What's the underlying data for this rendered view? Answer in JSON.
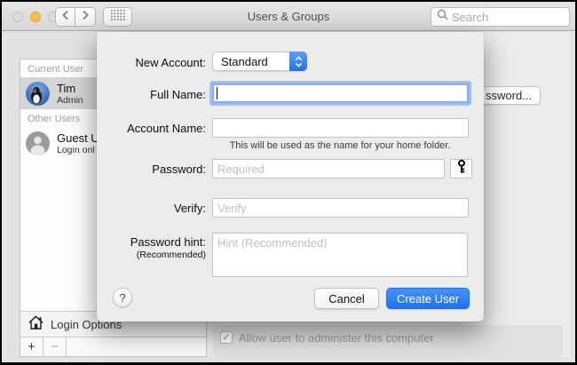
{
  "toolbar": {
    "title": "Users & Groups",
    "search_placeholder": "Search"
  },
  "sidebar": {
    "current_user_header": "Current User",
    "current_user": {
      "name": "Tim",
      "role": "Admin"
    },
    "other_users_header": "Other Users",
    "guest_user": {
      "name": "Guest U",
      "role": "Login onl"
    },
    "login_options_label": "Login Options",
    "add_label": "+",
    "remove_label": "−"
  },
  "detail": {
    "change_password_visible_label": "ssword...",
    "admin_checkbox_label": "Allow user to administer this computer",
    "admin_checkbox_glyph": "✓"
  },
  "sheet": {
    "new_account_label": "New Account:",
    "new_account_value": "Standard",
    "full_name_label": "Full Name:",
    "full_name_value": "",
    "account_name_label": "Account Name:",
    "account_name_value": "",
    "account_name_help": "This will be used as the name for your home folder.",
    "password_label": "Password:",
    "password_placeholder": "Required",
    "verify_label": "Verify:",
    "verify_placeholder": "Verify",
    "password_hint_label": "Password hint:",
    "password_hint_sublabel": "(Recommended)",
    "password_hint_placeholder": "Hint (Recommended)",
    "help_label": "?",
    "cancel_label": "Cancel",
    "create_label": "Create User"
  },
  "colors": {
    "accent_blue": "#2b7cf4",
    "minimize_yellow": "#f6be50",
    "sheet_background": "#ececec",
    "selected_row": "#d5d5d5"
  }
}
